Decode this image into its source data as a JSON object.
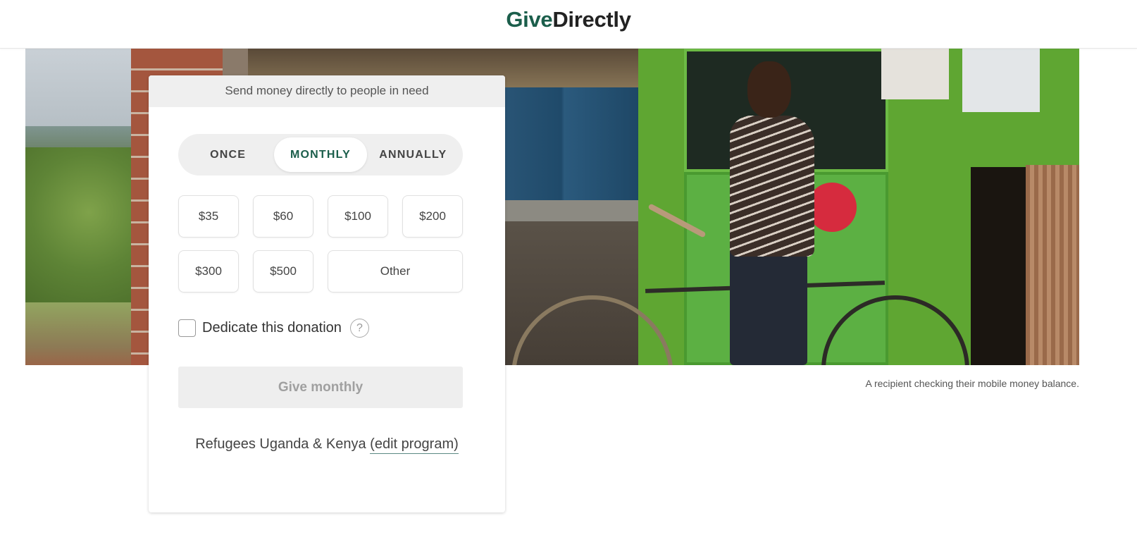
{
  "header": {
    "logo_give": "Give",
    "logo_directly": "Directly",
    "brand_color": "#1b5e4b"
  },
  "hero": {
    "image_description": "Man with bicycle checking his phone in front of a green shop",
    "caption": "A recipient checking their mobile money balance."
  },
  "donation_card": {
    "header": "Send money directly to people in need",
    "frequency": {
      "options": [
        {
          "label": "ONCE",
          "selected": false
        },
        {
          "label": "MONTHLY",
          "selected": true
        },
        {
          "label": "ANNUALLY",
          "selected": false
        }
      ]
    },
    "amounts": [
      "$35",
      "$60",
      "$100",
      "$200",
      "$300",
      "$500"
    ],
    "other_label": "Other",
    "dedicate": {
      "label": "Dedicate this donation",
      "checked": false,
      "help_icon": "?"
    },
    "submit_label": "Give monthly",
    "program": {
      "name": "Refugees Uganda & Kenya",
      "edit_label": "(edit program)"
    }
  }
}
